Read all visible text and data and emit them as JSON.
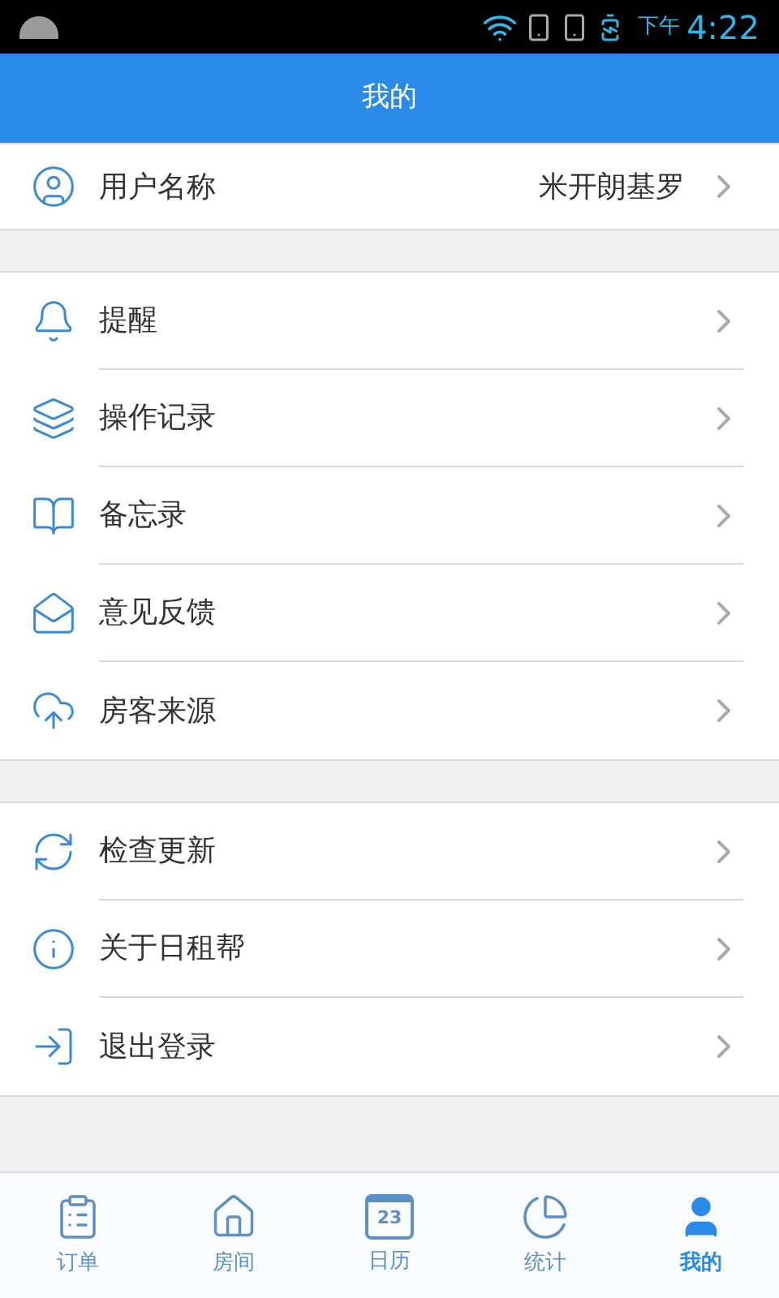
{
  "status_bar": {
    "time_period": "下午",
    "time": "4:22"
  },
  "header": {
    "title": "我的"
  },
  "groups": [
    {
      "items": [
        {
          "label": "用户名称",
          "value": "米开朗基罗"
        }
      ]
    },
    {
      "items": [
        {
          "label": "提醒"
        },
        {
          "label": "操作记录"
        },
        {
          "label": "备忘录"
        },
        {
          "label": "意见反馈"
        },
        {
          "label": "房客来源"
        }
      ]
    },
    {
      "items": [
        {
          "label": "检查更新"
        },
        {
          "label": "关于日租帮"
        },
        {
          "label": "退出登录"
        }
      ]
    }
  ],
  "bottom_nav": [
    {
      "label": "订单",
      "selected": false
    },
    {
      "label": "房间",
      "selected": false
    },
    {
      "label": "日历",
      "selected": false,
      "icon_text": "23"
    },
    {
      "label": "统计",
      "selected": false
    },
    {
      "label": "我的",
      "selected": true
    }
  ]
}
